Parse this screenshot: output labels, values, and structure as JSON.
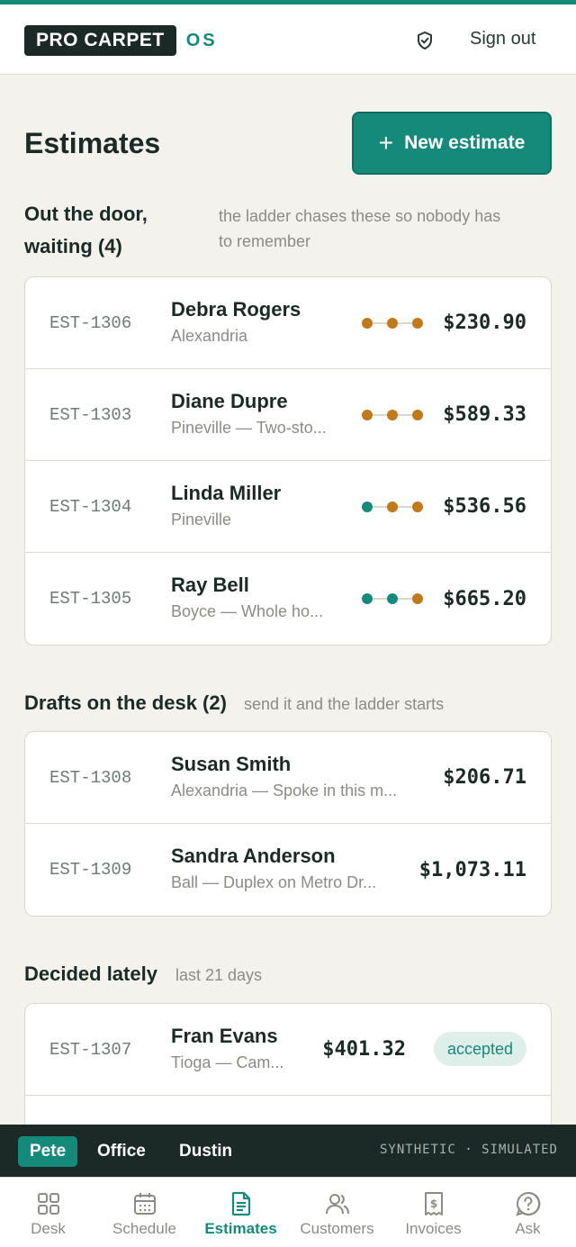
{
  "header": {
    "logo_main": "PRO CARPET",
    "logo_suffix": "OS",
    "sign_out": "Sign out"
  },
  "page": {
    "title": "Estimates",
    "new_estimate_label": "New estimate"
  },
  "sections": {
    "out": {
      "title_line1": "Out the door,",
      "title_line2": "waiting (4)",
      "note_line1": "the ladder chases these so nobody has",
      "note_line2": "to remember",
      "rows": [
        {
          "id": "EST-1306",
          "name": "Debra Rogers",
          "sub": "Alexandria",
          "amount": "$230.90",
          "ladder": [
            "amber",
            "amber",
            "amber"
          ]
        },
        {
          "id": "EST-1303",
          "name": "Diane Dupre",
          "sub": "Pineville — Two-sto...",
          "amount": "$589.33",
          "ladder": [
            "amber",
            "amber",
            "amber"
          ]
        },
        {
          "id": "EST-1304",
          "name": "Linda Miller",
          "sub": "Pineville",
          "amount": "$536.56",
          "ladder": [
            "teal",
            "amber",
            "amber"
          ]
        },
        {
          "id": "EST-1305",
          "name": "Ray Bell",
          "sub": "Boyce — Whole ho...",
          "amount": "$665.20",
          "ladder": [
            "teal",
            "teal",
            "amber"
          ]
        }
      ]
    },
    "drafts": {
      "title": "Drafts on the desk (2)",
      "note": "send it and the ladder starts",
      "rows": [
        {
          "id": "EST-1308",
          "name": "Susan Smith",
          "sub": "Alexandria — Spoke in this m...",
          "amount": "$206.71"
        },
        {
          "id": "EST-1309",
          "name": "Sandra Anderson",
          "sub": "Ball — Duplex on Metro Dr...",
          "amount": "$1,073.11"
        }
      ]
    },
    "decided": {
      "title": "Decided lately",
      "note": "last 21 days",
      "rows": [
        {
          "id": "EST-1307",
          "name": "Fran Evans",
          "sub": "Tioga — Cam...",
          "amount": "$401.32",
          "status": "accepted"
        }
      ]
    }
  },
  "personas": {
    "items": [
      "Pete",
      "Office",
      "Dustin"
    ],
    "active": "Pete",
    "mode_label": "SYNTHETIC · SIMULATED"
  },
  "nav": {
    "items": [
      {
        "label": "Desk",
        "icon": "grid-icon"
      },
      {
        "label": "Schedule",
        "icon": "calendar-icon"
      },
      {
        "label": "Estimates",
        "icon": "document-icon"
      },
      {
        "label": "Customers",
        "icon": "users-icon"
      },
      {
        "label": "Invoices",
        "icon": "receipt-icon"
      },
      {
        "label": "Ask",
        "icon": "help-icon"
      }
    ],
    "active": "Estimates"
  },
  "colors": {
    "accent": "#168a7a",
    "dark": "#1b2a26",
    "amber": "#c07a1c",
    "teal": "#168a7a",
    "background": "#f4f2ec"
  }
}
